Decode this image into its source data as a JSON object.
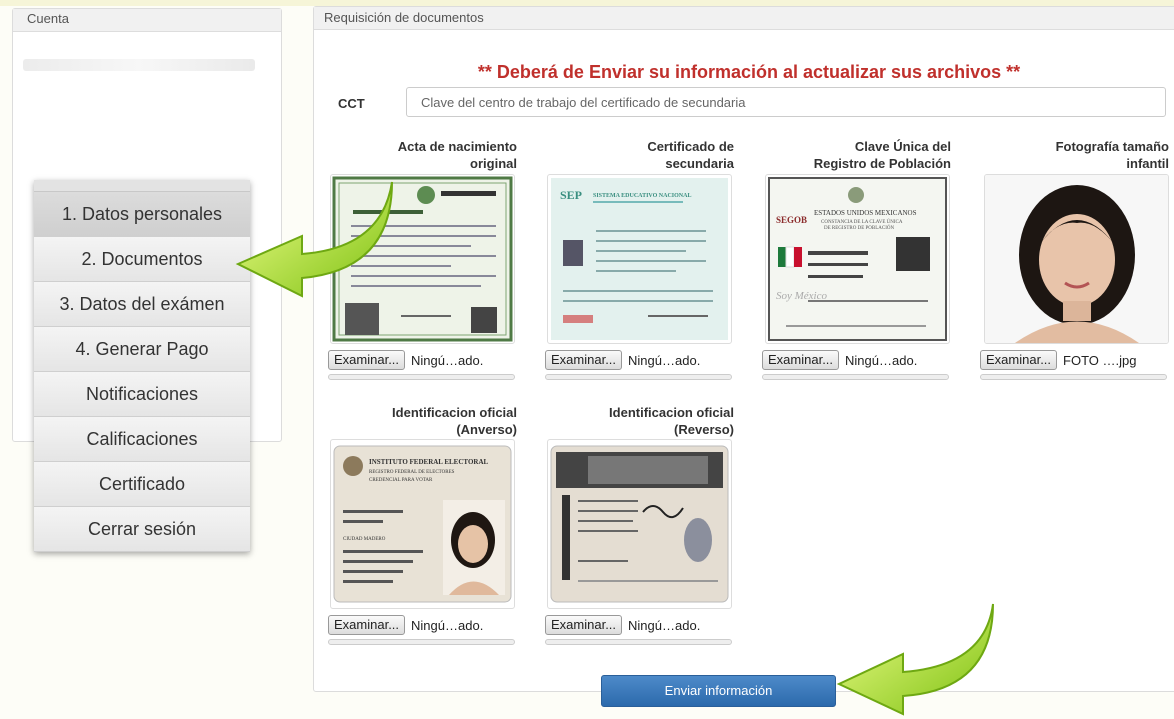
{
  "account": {
    "title": "Cuenta"
  },
  "nav": {
    "items": [
      {
        "label": "1. Datos personales"
      },
      {
        "label": "2. Documentos"
      },
      {
        "label": "3. Datos del exámen"
      },
      {
        "label": "4. Generar Pago"
      },
      {
        "label": "Notificaciones"
      },
      {
        "label": "Calificaciones"
      },
      {
        "label": "Certificado"
      },
      {
        "label": "Cerrar sesión"
      }
    ]
  },
  "main": {
    "title": "Requisición de documentos",
    "notice": "** Deberá de Enviar su información al actualizar sus archivos **",
    "cct": {
      "label": "CCT",
      "placeholder": "Clave del centro de trabajo del certificado de secundaria"
    },
    "documents": [
      {
        "title_1": "Acta de nacimiento",
        "title_2": "original",
        "button": "Examinar...",
        "file": "Ningú…ado."
      },
      {
        "title_1": "Certificado de",
        "title_2": "secundaria",
        "button": "Examinar...",
        "file": "Ningú…ado."
      },
      {
        "title_1": "Clave Única del",
        "title_2": "Registro de Población",
        "button": "Examinar...",
        "file": "Ningú…ado."
      },
      {
        "title_1": "Fotografía tamaño",
        "title_2": "infantil",
        "button": "Examinar...",
        "file": "FOTO ….jpg"
      },
      {
        "title_1": "Identificacion oficial",
        "title_2": "(Anverso)",
        "button": "Examinar...",
        "file": "Ningú…ado."
      },
      {
        "title_1": "Identificacion oficial",
        "title_2": "(Reverso)",
        "button": "Examinar...",
        "file": "Ningú…ado."
      }
    ],
    "thumb_text": {
      "sep": "SEP",
      "sep_title": "SISTEMA EDUCATIVO NACIONAL",
      "curp_country": "ESTADOS UNIDOS MEXICANOS",
      "curp_sub": "CONSTANCIA DE LA CLAVE ÚNICA",
      "curp_sub2": "DE REGISTRO DE POBLACIÓN",
      "segob": "SEGOB",
      "soy_mexico": "Soy México",
      "ine_1": "INSTITUTO FEDERAL ELECTORAL",
      "ine_2": "REGISTRO FEDERAL DE ELECTORES",
      "ine_3": "CREDENCIAL PARA VOTAR",
      "ine_city": "CIUDAD MADERO"
    },
    "submit": "Enviar información"
  },
  "colors": {
    "notice": "#c0302c",
    "submit": "#3a79bb",
    "arrow": "#9bd21a"
  }
}
